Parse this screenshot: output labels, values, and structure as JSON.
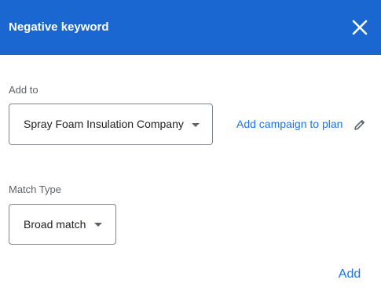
{
  "header": {
    "title": "Negative keyword",
    "close_icon": "close-icon",
    "background": "#1a67d2"
  },
  "add_to": {
    "label": "Add to",
    "selected": "Spray Foam Insulation Company",
    "link": "Add campaign to plan",
    "link_icon": "pencil-icon"
  },
  "match_type": {
    "label": "Match Type",
    "selected": "Broad match"
  },
  "actions": {
    "add_label": "Add"
  },
  "colors": {
    "accent": "#1a73e8",
    "label_gray": "#5f6368"
  }
}
